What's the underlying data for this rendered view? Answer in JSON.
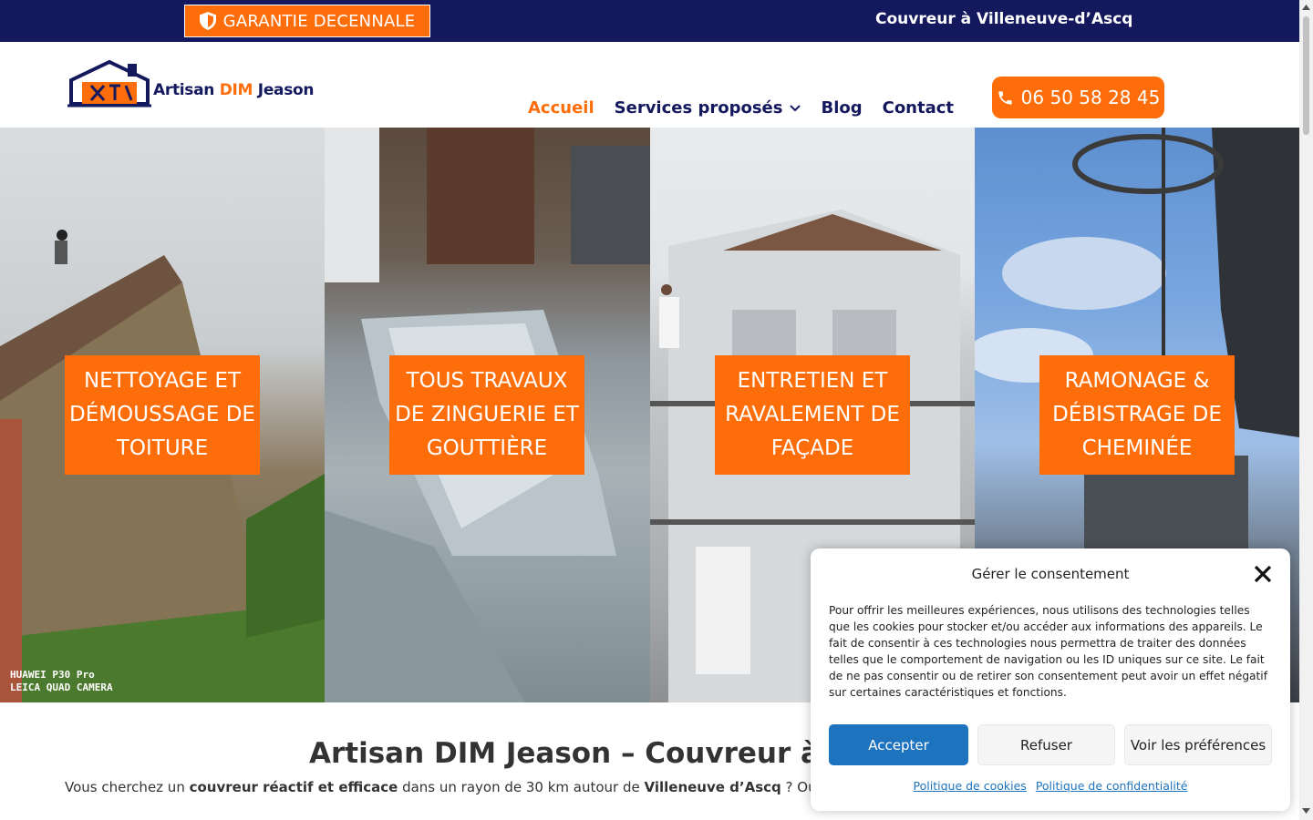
{
  "topbar": {
    "badge_label": "GARANTIE DECENNALE",
    "title": "Couvreur à Villeneuve-d’Ascq",
    "background_color": "#14195e",
    "badge_color": "#fd6e0b"
  },
  "header": {
    "logo": {
      "text_part1": "Artisan ",
      "text_part2": "DIM",
      "text_part3": " Jeason",
      "icon": "house-tools-icon"
    },
    "nav": [
      {
        "label": "Accueil",
        "active": true
      },
      {
        "label": "Services proposés",
        "has_dropdown": true
      },
      {
        "label": "Blog"
      },
      {
        "label": "Contact"
      }
    ],
    "phone": {
      "label": "06 50 58 28 45",
      "icon": "phone-icon"
    }
  },
  "hero": {
    "panels": [
      {
        "label": "NETTOYAGE ET DÉMOUSSAGE DE TOITURE",
        "watermark_line1": "HUAWEI P30 Pro",
        "watermark_line2": "LEICA QUAD CAMERA"
      },
      {
        "label": "TOUS TRAVAUX DE ZINGUERIE ET GOUTTIÈRE"
      },
      {
        "label": "ENTRETIEN ET RAVALEMENT DE FAÇADE"
      },
      {
        "label": "RAMONAGE & DÉBISTRAGE DE CHEMINÉE"
      }
    ]
  },
  "content": {
    "heading": "Artisan DIM Jeason – Couvreur à Ville",
    "para1": {
      "t1": "Vous cherchez un ",
      "b1": "couvreur réactif et efficace",
      "t2": " dans un rayon de 30 km autour de ",
      "b2": "Villeneuve d’Ascq",
      "t3": " ? Ou un façadier expérim"
    }
  },
  "cookie": {
    "title": "Gérer le consentement",
    "text": "Pour offrir les meilleures expériences, nous utilisons des technologies telles que les cookies pour stocker et/ou accéder aux informations des appareils. Le fait de consentir à ces technologies nous permettra de traiter des données telles que le comportement de navigation ou les ID uniques sur ce site. Le fait de ne pas consentir ou de retirer son consentement peut avoir un effet négatif sur certaines caractéristiques et fonctions.",
    "accept_label": "Accepter",
    "refuse_label": "Refuser",
    "prefs_label": "Voir les préférences",
    "link_cookies": "Politique de cookies",
    "link_privacy": "Politique de confidentialité",
    "accent_color": "#1e73be"
  }
}
